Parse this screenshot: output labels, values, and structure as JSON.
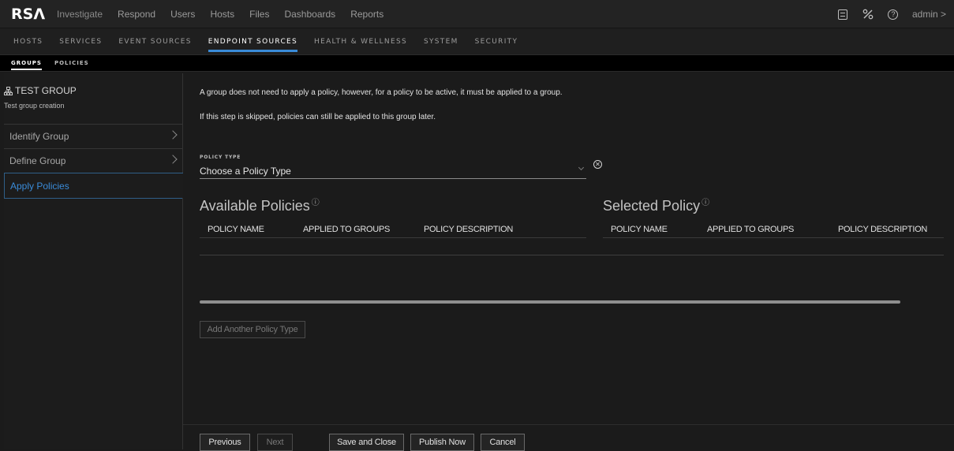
{
  "app": {
    "logo": "RSΛ",
    "main_nav": [
      "Investigate",
      "Respond",
      "Users",
      "Hosts",
      "Files",
      "Dashboards",
      "Reports"
    ],
    "user": "admin >"
  },
  "admin_nav": [
    "HOSTS",
    "SERVICES",
    "EVENT SOURCES",
    "ENDPOINT SOURCES",
    "HEALTH & WELLNESS",
    "SYSTEM",
    "SECURITY"
  ],
  "admin_nav_active": "ENDPOINT SOURCES",
  "sub_nav": [
    "GROUPS",
    "POLICIES"
  ],
  "sidebar": {
    "group_name": "TEST GROUP",
    "group_desc": "Test group creation",
    "steps": [
      {
        "label": "Identify Group"
      },
      {
        "label": "Define Group"
      },
      {
        "label": "Apply Policies"
      }
    ]
  },
  "main": {
    "intro_1": "A group does not need to apply a policy, however, for a policy to be active, it must be applied to a group.",
    "intro_2": "If this step is skipped, policies can still be applied to this group later.",
    "policy_type_label": "POLICY TYPE",
    "policy_type_placeholder": "Choose a Policy Type",
    "available_title": "Available Policies",
    "selected_title": "Selected Policy",
    "available_columns": [
      "POLICY NAME",
      "APPLIED TO GROUPS",
      "POLICY DESCRIPTION"
    ],
    "selected_columns": [
      "POLICY NAME",
      "APPLIED TO GROUPS",
      "POLICY DESCRIPTION"
    ],
    "add_policy_type": "Add Another Policy Type"
  },
  "footer": {
    "previous": "Previous",
    "next": "Next",
    "save_close": "Save and Close",
    "publish_now": "Publish Now",
    "cancel": "Cancel"
  },
  "colors": {
    "accent": "#3a8bd8",
    "background": "#1b1b1b"
  }
}
